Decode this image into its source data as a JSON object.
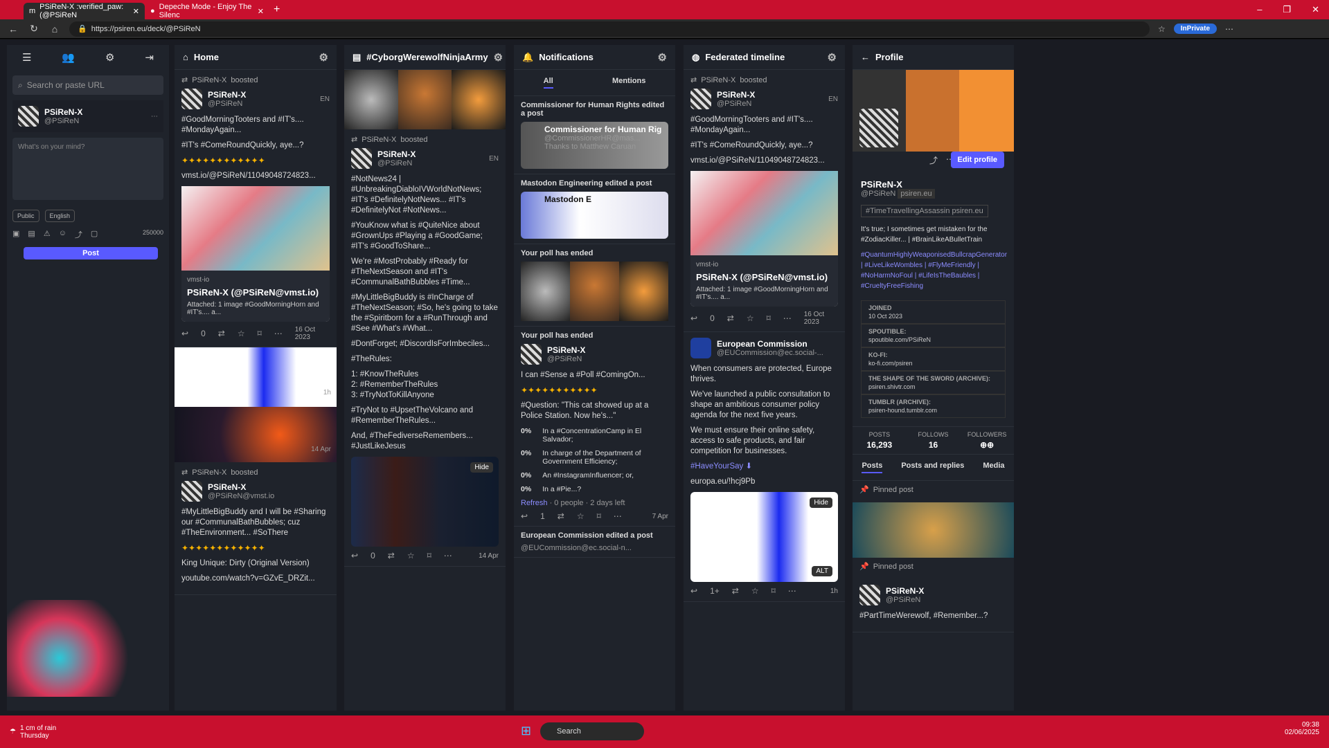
{
  "browser": {
    "tab1": "PSiReN-X :verified_paw: (@PSiReN",
    "tab2": "Depeche Mode - Enjoy The Silenc",
    "url": "https://psiren.eu/deck/@PSiReN",
    "inprivate": "InPrivate"
  },
  "sidebar": {
    "search_placeholder": "Search or paste URL",
    "name": "PSiReN-X",
    "handle": "@PSiReN",
    "compose_placeholder": "What's on your mind?",
    "public": "Public",
    "language": "English",
    "char_count": "250000",
    "post": "Post"
  },
  "columns": {
    "home": {
      "title": "Home"
    },
    "cyborg": {
      "title": "#CyborgWerewolfNinjaArmy"
    },
    "notifications": {
      "title": "Notifications",
      "tab_all": "All",
      "tab_mentions": "Mentions"
    },
    "federated": {
      "title": "Federated timeline"
    },
    "profile": {
      "title": "Profile"
    }
  },
  "home_posts": {
    "boost": "PSiReN-X",
    "boosted": "boosted",
    "name": "PSiReN-X",
    "handle": "@PSiReN",
    "lang": "EN",
    "text1": "#GoodMorningTooters and #IT's.... #MondayAgain...",
    "text2": "#IT's #ComeRoundQuickly, aye...?",
    "link": "vmst.io/@PSiReN/11049048724823...",
    "card_src": "vmst-io",
    "card_title": "PSiReN-X (@PSiReN@vmst.io)",
    "card_sub": "Attached: 1 image #GoodMorningHorn and #IT's.... a...",
    "reply": "0",
    "date": "16 Oct 2023",
    "eu_date": "1h",
    "fire_date": "14 Apr",
    "p3_handle": "@PSiReN@vmst.io",
    "p3_text": "#MyLittleBigBuddy and I will be #Sharing our #CommunalBathBubbles; cuz #TheEnvironment... #SoThere",
    "p3_song": "King Unique: Dirty (Original Version)",
    "p3_link": "youtube.com/watch?v=GZvE_DRZit..."
  },
  "cyborg_posts": {
    "name": "PSiReN-X",
    "handle": "@PSiReN",
    "boosted": "boosted",
    "lang": "EN",
    "t1": "#NotNews24 | #UnbreakingDiabloIVWorldNotNews; #IT's #DefinitelyNotNews... #IT's #DefinitelyNot #NotNews...",
    "t2": "#YouKnow what is #QuiteNice about #GrownUps #Playing a #GoodGame; #IT's #GoodToShare...",
    "t3": "We're #MostProbably #Ready for #TheNextSeason and #IT's #CommunalBathBubbles #Time...",
    "t4": "#MyLittleBigBuddy is #InCharge of #TheNextSeason; #So, he's going to take the #Spiritborn for a #RunThrough and #See #What's #What...",
    "t5": "#DontForget; #DiscordIsForImbeciles...",
    "t6": "#TheRules:",
    "r1": "1: #KnowTheRules",
    "r2": "2: #RememberTheRules",
    "r3": "3: #TryNotToKillAnyone",
    "t7": "#TryNot to #UpsetTheVolcano and #RememberTheRules...",
    "t8": "And, #TheFediverseRemembers... #JustLikeJesus",
    "hide": "Hide",
    "reply": "0",
    "date": "14 Apr"
  },
  "notifications": {
    "n1": "Commissioner for Human Rights edited a post",
    "n1_name": "Commissioner for Human Rig",
    "n1_handle": "@CommissionerHR@mas...",
    "n1_sub": "Thanks to Matthew Caruan",
    "n2": "Mastodon Engineering edited a post",
    "n2_name": "Mastodon E",
    "n3": "Your poll has ended",
    "n4": "Your poll has ended",
    "poll_q": "I can #Sense a #Poll #ComingOn...",
    "poll_q2": "#Question: \"This cat showed up at a Police Station. Now he's...\"",
    "o1": "In a #ConcentrationCamp in El Salvador;",
    "o2": "In charge of the Department of Government Efficiency;",
    "o3": "An #InstagramInfluencer; or,",
    "o4": "In a #Pie...?",
    "pct": "0%",
    "refresh": "Refresh",
    "refresh_meta": " · 0 people · 2 days left",
    "reply": "1",
    "date": "7 Apr",
    "n5": "European Commission edited a post",
    "n5_handle": "@EUCommission@ec.social-n..."
  },
  "federated": {
    "ec_name": "European Commission",
    "ec_handle": "@EUCommission@ec.social-...",
    "ec1": "When consumers are protected, Europe thrives.",
    "ec2": "We've launched a public consultation to shape an ambitious consumer policy agenda for the next five years.",
    "ec3": "We must ensure their online safety, access to safe products, and fair competition for businesses.",
    "ec4": "#HaveYourSay ⬇",
    "ec_link": "europa.eu/!hcj9Pb",
    "alt": "ALT",
    "hide": "Hide",
    "reply": "1+",
    "date": "1h"
  },
  "profile": {
    "name": "PSiReN-X",
    "handle": "@PSiReN",
    "domain": "psiren.eu",
    "edit": "Edit profile",
    "tag": "#TimeTravellingAssassin psiren.eu",
    "bio1": "It's true; I sometimes get mistaken for the #ZodiacKiller... | #BrainLikeABulletTrain",
    "bio2": "#QuantumHighlyWeaponisedBullcrapGenerator | #LiveLikeWombles | #FlyMeFriendly | #NoHarmNoFoul | #LifeIsTheBaubles | #CrueltyFreeFishing",
    "joined_k": "JOINED",
    "joined_v": "10 Oct 2023",
    "spout_k": "SPOUTIBLE:",
    "spout_v": "spoutible.com/PSiReN",
    "kofi_k": "KO-FI:",
    "kofi_v": "ko-fi.com/psiren",
    "shape_k": "THE SHAPE OF THE SWORD (ARCHIVE):",
    "shape_v": "psiren.shivtr.com",
    "tumblr_k": "TUMBLR (ARCHIVE):",
    "tumblr_v": "psiren-hound.tumblr.com",
    "posts_k": "POSTS",
    "posts_v": "16,293",
    "follows_k": "FOLLOWS",
    "follows_v": "16",
    "followers_k": "FOLLOWERS",
    "followers_v": "⊕⊕",
    "tab_posts": "Posts",
    "tab_replies": "Posts and replies",
    "tab_media": "Media",
    "pinned": "Pinned post",
    "pin_text": "#PartTimeWerewolf, #Remember...?"
  },
  "taskbar": {
    "weather": "1 cm of rain",
    "weather_sub": "Thursday",
    "search": "Search",
    "time": "09:38",
    "date": "02/06/2025"
  }
}
